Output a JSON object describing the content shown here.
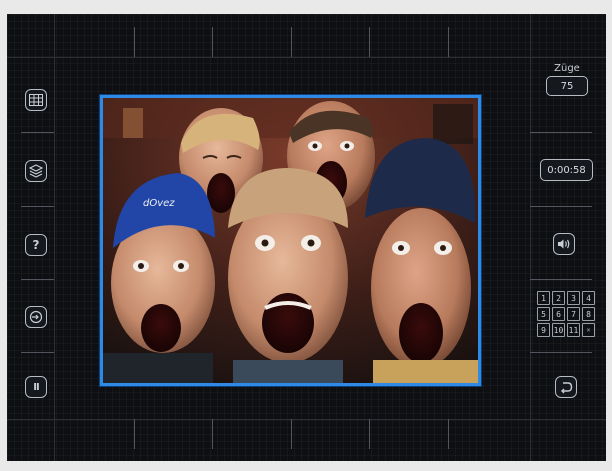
{
  "sidebar_left": {
    "items": [
      {
        "name": "grid-icon"
      },
      {
        "name": "layers-icon"
      },
      {
        "name": "question-icon",
        "glyph": "?"
      },
      {
        "name": "enter-icon"
      },
      {
        "name": "pause-icon",
        "glyph": "II"
      }
    ]
  },
  "moves": {
    "label": "Züge",
    "value": "75"
  },
  "timer": {
    "value": "0:00:58"
  },
  "tile_grid": {
    "numbers": [
      "1",
      "2",
      "3",
      "4",
      "5",
      "6",
      "7",
      "8",
      "9",
      "10",
      "11",
      ""
    ]
  },
  "colors": {
    "frame_accent": "#2f8ae6",
    "panel_bg": "#0d0f12"
  },
  "photo": {
    "subject": "puzzle-image",
    "cap_text": "dOvez"
  }
}
